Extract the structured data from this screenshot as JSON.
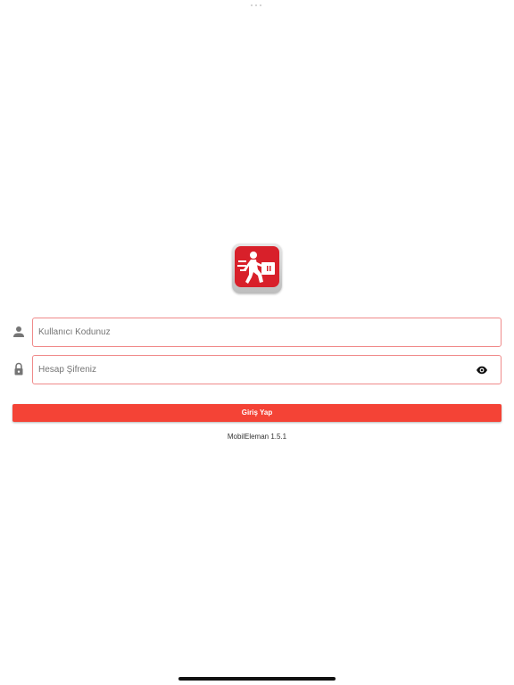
{
  "logo": {
    "icon": "courier-running-with-box-logo",
    "brand_color": "#d8202a"
  },
  "login_form": {
    "username": {
      "icon": "person-icon",
      "placeholder": "Kullanıcı Kodunuz",
      "value": ""
    },
    "password": {
      "icon": "lock-icon",
      "placeholder": "Hesap Şifreniz",
      "value": "",
      "toggle_icon": "eye-icon"
    },
    "field_border_color": "#f08a8a",
    "submit_label": "Giriş Yap",
    "submit_color": "#f44336"
  },
  "footer": {
    "version": "MobilEleman 1.5.1"
  }
}
